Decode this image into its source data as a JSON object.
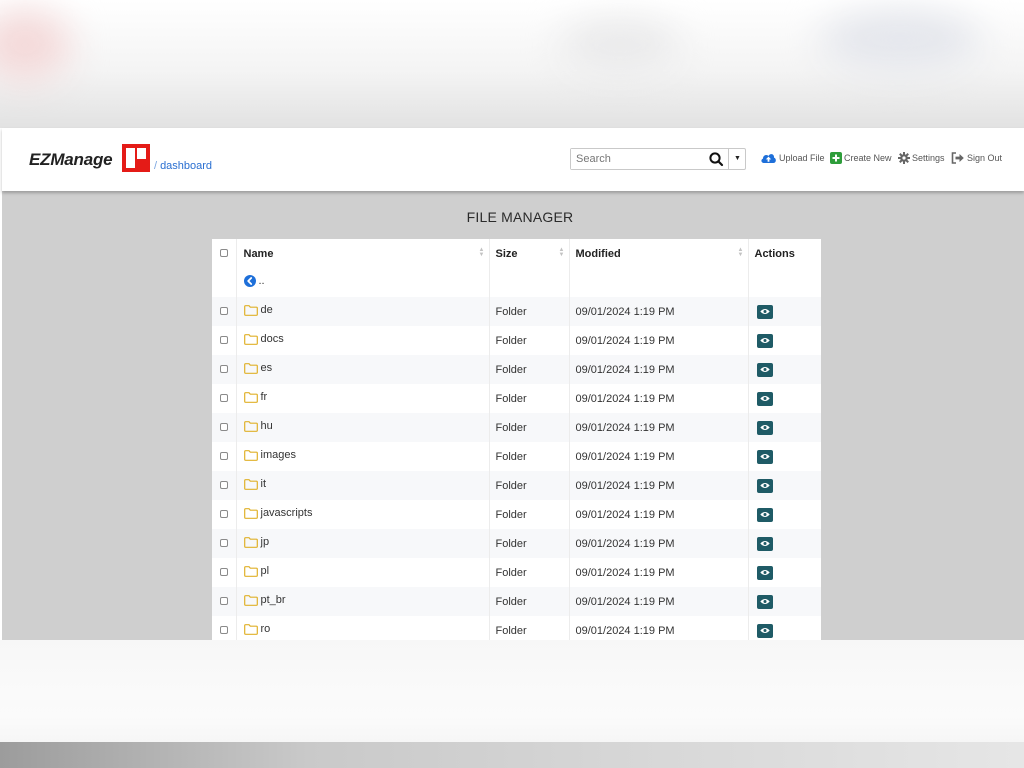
{
  "app": {
    "brand": "EZManage",
    "breadcrumb_sep": "/",
    "breadcrumb": "dashboard"
  },
  "search": {
    "placeholder": "Search"
  },
  "nav": {
    "upload": "Upload File",
    "create": "Create New",
    "settings": "Settings",
    "signout": "Sign Out"
  },
  "page": {
    "title": "FILE MANAGER"
  },
  "table": {
    "headers": {
      "name": "Name",
      "size": "Size",
      "modified": "Modified",
      "actions": "Actions"
    },
    "parent_label": "..",
    "rows": [
      {
        "name": "de",
        "size": "Folder",
        "modified": "09/01/2024 1:19 PM"
      },
      {
        "name": "docs",
        "size": "Folder",
        "modified": "09/01/2024 1:19 PM"
      },
      {
        "name": "es",
        "size": "Folder",
        "modified": "09/01/2024 1:19 PM"
      },
      {
        "name": "fr",
        "size": "Folder",
        "modified": "09/01/2024 1:19 PM"
      },
      {
        "name": "hu",
        "size": "Folder",
        "modified": "09/01/2024 1:19 PM"
      },
      {
        "name": "images",
        "size": "Folder",
        "modified": "09/01/2024 1:19 PM"
      },
      {
        "name": "it",
        "size": "Folder",
        "modified": "09/01/2024 1:19 PM"
      },
      {
        "name": "javascripts",
        "size": "Folder",
        "modified": "09/01/2024 1:19 PM"
      },
      {
        "name": "jp",
        "size": "Folder",
        "modified": "09/01/2024 1:19 PM"
      },
      {
        "name": "pl",
        "size": "Folder",
        "modified": "09/01/2024 1:19 PM"
      },
      {
        "name": "pt_br",
        "size": "Folder",
        "modified": "09/01/2024 1:19 PM"
      },
      {
        "name": "ro",
        "size": "Folder",
        "modified": "09/01/2024 1:19 PM"
      }
    ]
  },
  "colors": {
    "accent": "#2a6fd1",
    "logo": "#e41b17",
    "action_button": "#1f5b66",
    "folder": "#e0b12a",
    "create_icon": "#2e9d3a"
  }
}
